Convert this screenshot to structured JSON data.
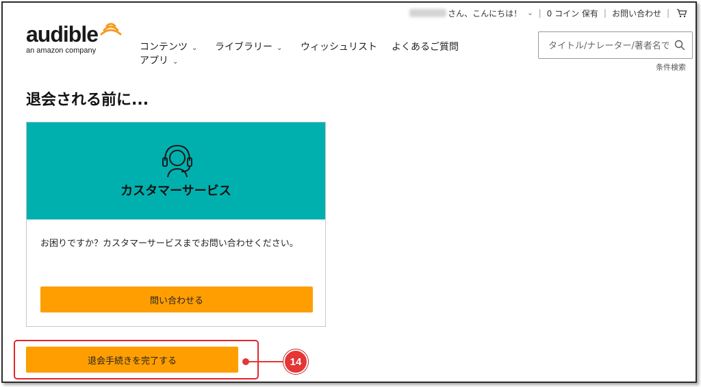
{
  "header": {
    "greeting": "さん、こんにちは！",
    "coins": "0 コイン 保有",
    "contact": "お問い合わせ",
    "logo": {
      "word": "audible",
      "tagline": "an amazon company"
    }
  },
  "nav": {
    "items": [
      {
        "label": "コンテンツ"
      },
      {
        "label": "ライブラリー"
      },
      {
        "label": "ウィッシュリスト"
      },
      {
        "label": "よくあるご質問"
      },
      {
        "label": "アプリ"
      }
    ]
  },
  "search": {
    "placeholder": "タイトル/ナレーター/著者名で",
    "advanced": "条件検索"
  },
  "page": {
    "title": "退会される前に..."
  },
  "support_card": {
    "title": "カスタマーサービス",
    "description": "お困りですか？カスタマーサービスまでお問い合わせください。",
    "button": "問い合わせる"
  },
  "withdraw": {
    "button": "退会手続きを完了する"
  },
  "annotation": {
    "step": "14"
  },
  "colors": {
    "accent": "#ff9e00",
    "teal": "#00b0ae",
    "annotation_red": "#e53535"
  }
}
